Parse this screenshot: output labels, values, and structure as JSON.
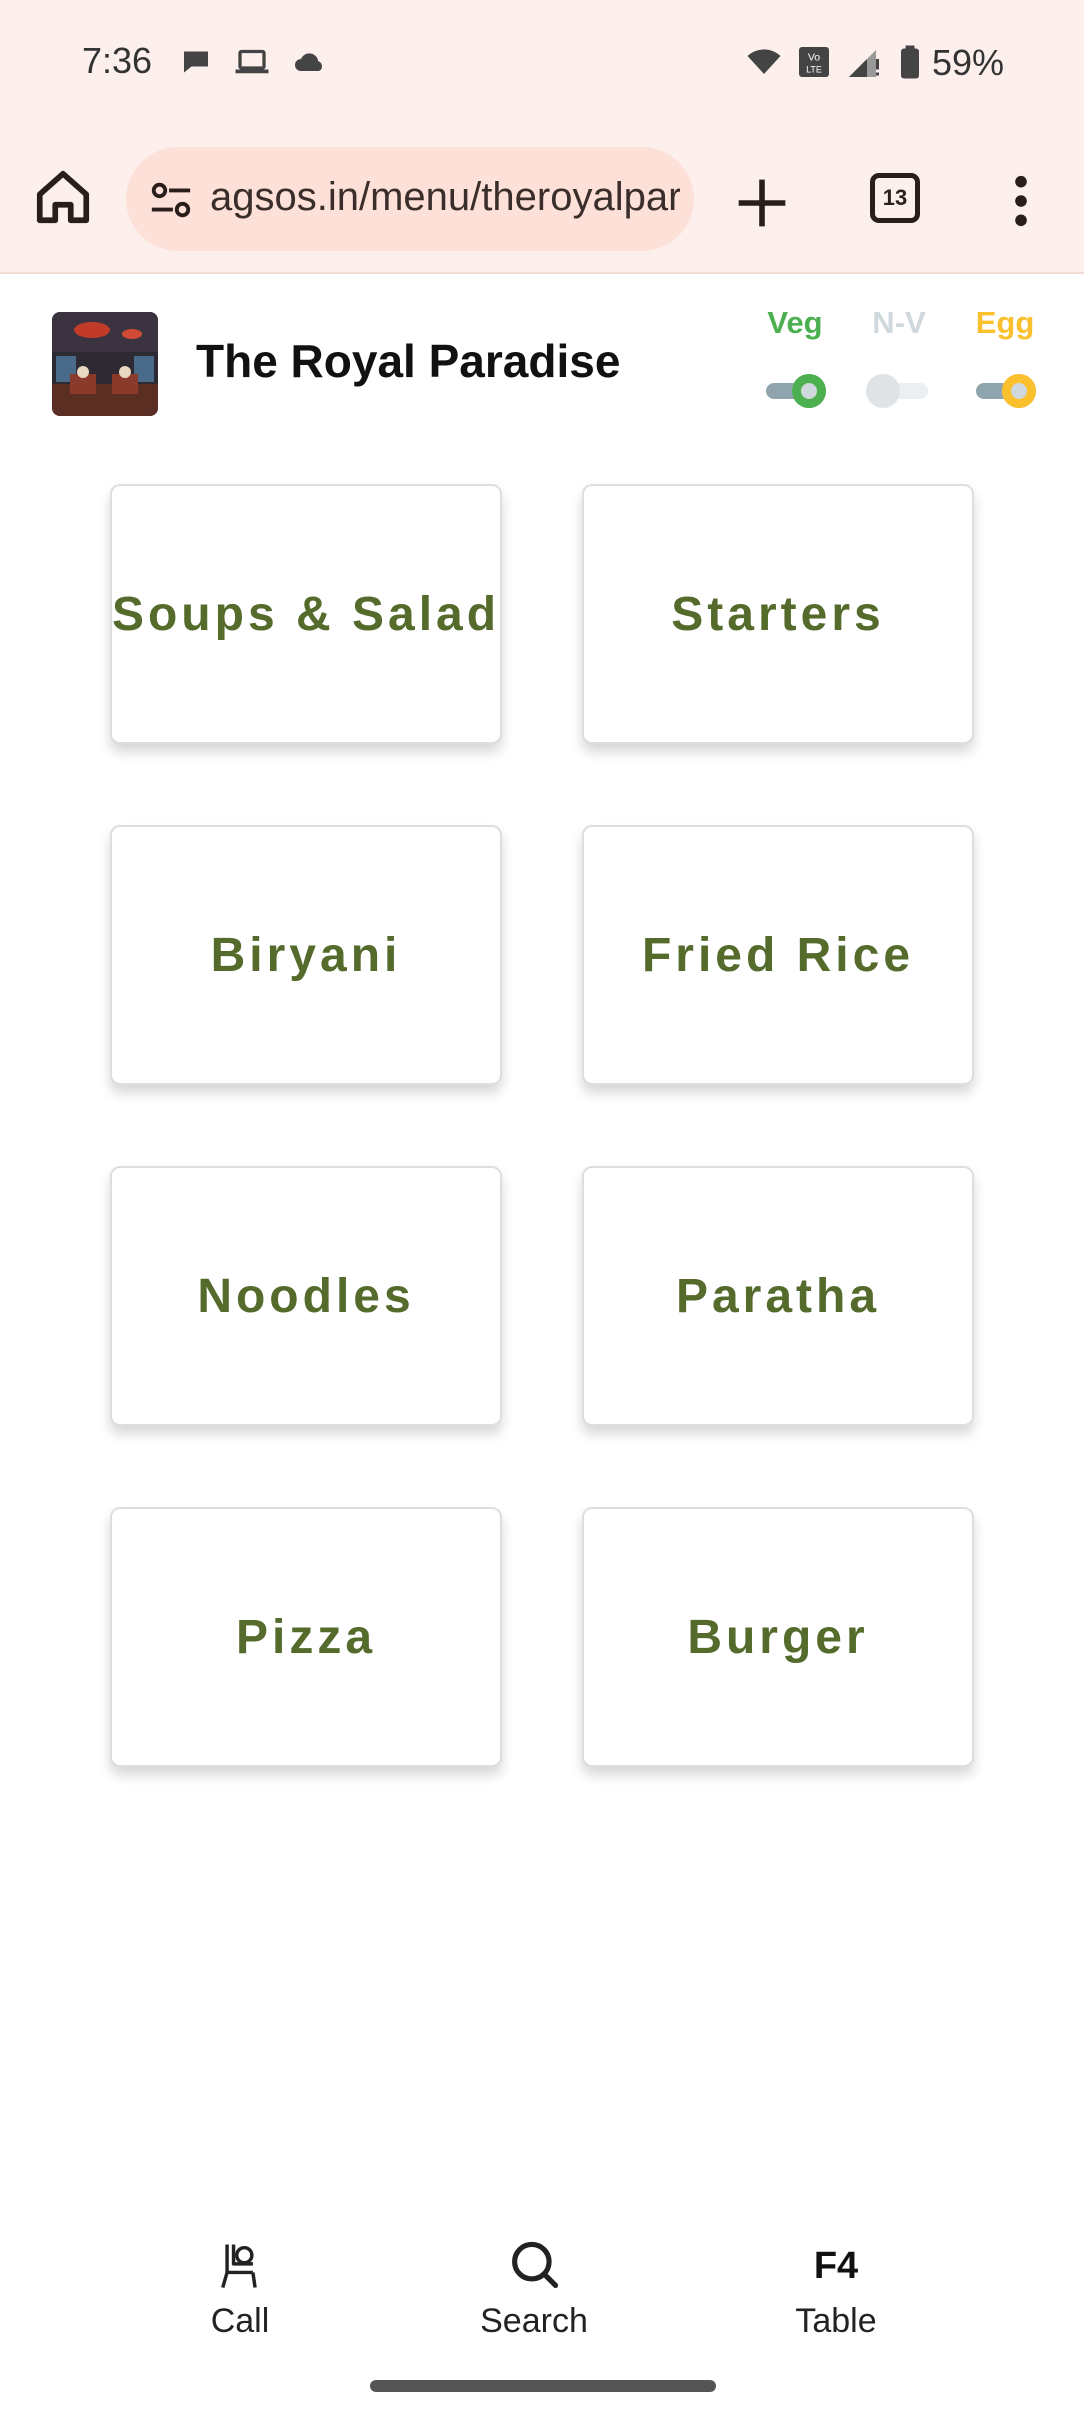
{
  "status_bar": {
    "time": "7:36",
    "battery": "59%",
    "icons": [
      "chat-bubble-icon",
      "laptop-icon",
      "cloud-icon",
      "wifi-icon",
      "volte-icon",
      "signal-icon",
      "battery-icon"
    ]
  },
  "browser": {
    "url": "agsos.in/menu/theroyalparadise",
    "tab_count": "13"
  },
  "header": {
    "restaurant_name": "The Royal Paradise",
    "filters": [
      {
        "label": "Veg",
        "color": "#4caf50",
        "on": true
      },
      {
        "label": "N-V",
        "color": "#cfd8dc",
        "on": false
      },
      {
        "label": "Egg",
        "color": "#fbc02d",
        "on": true
      }
    ]
  },
  "categories": [
    {
      "label": "Soups & Salad"
    },
    {
      "label": "Starters"
    },
    {
      "label": "Biryani"
    },
    {
      "label": "Fried Rice"
    },
    {
      "label": "Noodles"
    },
    {
      "label": "Paratha"
    },
    {
      "label": "Pizza"
    },
    {
      "label": "Burger"
    }
  ],
  "bottom_nav": {
    "call_label": "Call",
    "search_label": "Search",
    "table_code": "F4",
    "table_label": "Table"
  },
  "colors": {
    "accent_text": "#546b2c",
    "browser_bg": "#fdf0ec",
    "url_bar_bg": "#fde0d8"
  }
}
